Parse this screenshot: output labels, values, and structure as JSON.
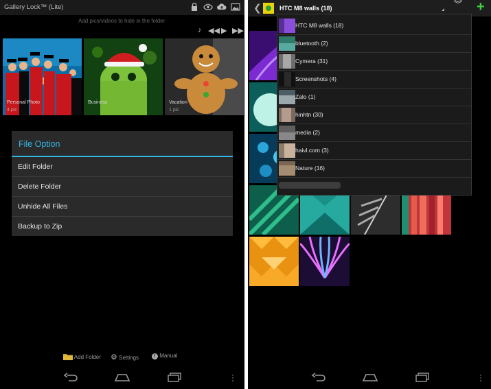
{
  "left_app": {
    "title": "Gallery Lock™ (Lite)",
    "hint": "Add pics/videos to hide in the folder.",
    "albums": [
      {
        "label": "Personal Photo",
        "count": "4 pic"
      },
      {
        "label": "Business",
        "count": ""
      },
      {
        "label": "Vacation",
        "count": "1 pic"
      }
    ],
    "dialog": {
      "title": "File Option",
      "items": [
        "Edit Folder",
        "Delete Folder",
        "Unhide All Files",
        "Backup to Zip"
      ]
    },
    "bottom": {
      "add_folder": "Add Folder",
      "settings": "Settings",
      "manual": "Manual"
    }
  },
  "right_app": {
    "folder_selected": "HTC M8 walls (18)",
    "folders": [
      "HTC M8 walls (18)",
      "bluetooth (2)",
      "Cymera (31)",
      "Screenshots (4)",
      "Zalo (1)",
      "hinhtn (30)",
      "media (2)",
      "haivl.com (3)",
      "Nature (16)"
    ],
    "colors": {
      "accent": "#33b5e5",
      "add_green": "#3fd23f"
    }
  }
}
